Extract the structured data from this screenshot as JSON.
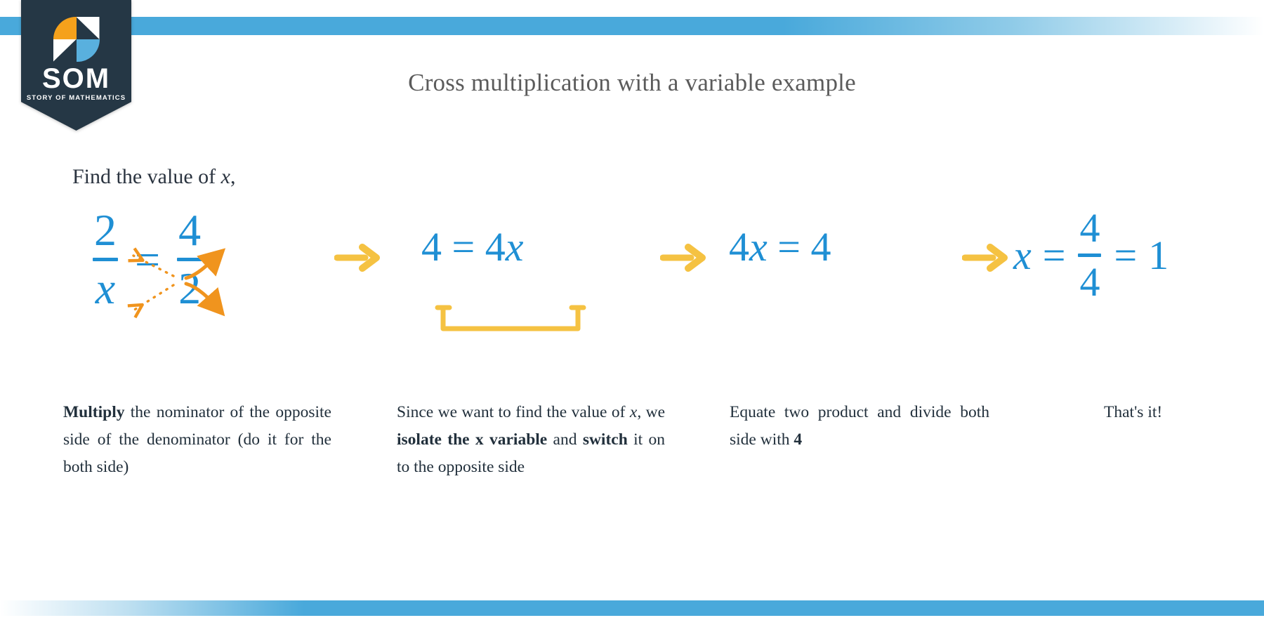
{
  "brand": {
    "name": "SOM",
    "tagline": "STORY OF MATHEMATICS",
    "banner_color": "#253745",
    "mark_orange": "#f5a11b",
    "mark_blue": "#59b0de",
    "mark_white": "#ffffff"
  },
  "decor": {
    "bar_color": "#49a9db"
  },
  "header": {
    "title": "Cross multiplication with a variable example"
  },
  "problem": {
    "prompt_prefix": "Find the value of ",
    "prompt_variable": "x",
    "prompt_suffix": ","
  },
  "math_color": "#1f8fd4",
  "arrow_color": "#f5c242",
  "cross_arrow_color": "#f0941e",
  "steps": [
    {
      "id": "step-1",
      "left": {
        "numerator": "2",
        "denominator": "x"
      },
      "relation": "=",
      "right": {
        "numerator": "4",
        "denominator": "2"
      },
      "annotation": "cross-multiplication-arrows"
    },
    {
      "id": "step-2",
      "expression": "4 = 4x",
      "lhs": "4",
      "relation": "=",
      "rhs_coefficient": "4",
      "rhs_variable": "x",
      "annotation": "underbrace-highlight"
    },
    {
      "id": "step-3",
      "expression": "4x = 4",
      "lhs_coefficient": "4",
      "lhs_variable": "x",
      "relation": "=",
      "rhs": "4"
    },
    {
      "id": "step-4",
      "variable": "x",
      "relation1": "=",
      "fraction": {
        "numerator": "4",
        "denominator": "4"
      },
      "relation2": "=",
      "result": "1"
    }
  ],
  "transitions": [
    {
      "id": "transition-1",
      "glyph": "arrow-right"
    },
    {
      "id": "transition-2",
      "glyph": "arrow-right"
    },
    {
      "id": "transition-3",
      "glyph": "arrow-right"
    }
  ],
  "captions": [
    {
      "id": "caption-1",
      "segments": [
        {
          "text": "Multiply",
          "style": "bold"
        },
        {
          "text": " the nominator of the opposite side of the denominator (do it for the both side)",
          "style": "normal"
        }
      ]
    },
    {
      "id": "caption-2",
      "segments": [
        {
          "text": "Since we want to find the value of ",
          "style": "normal"
        },
        {
          "text": "x",
          "style": "italic"
        },
        {
          "text": ", we ",
          "style": "normal"
        },
        {
          "text": "isolate the x variable",
          "style": "bold"
        },
        {
          "text": " and ",
          "style": "normal"
        },
        {
          "text": "switch",
          "style": "bold"
        },
        {
          "text": " it on to the opposite side",
          "style": "normal"
        }
      ]
    },
    {
      "id": "caption-3",
      "segments": [
        {
          "text": "Equate two product and divide both side with ",
          "style": "normal"
        },
        {
          "text": "4",
          "style": "bold"
        }
      ]
    },
    {
      "id": "caption-4",
      "segments": [
        {
          "text": "That's it!",
          "style": "normal"
        }
      ]
    }
  ]
}
